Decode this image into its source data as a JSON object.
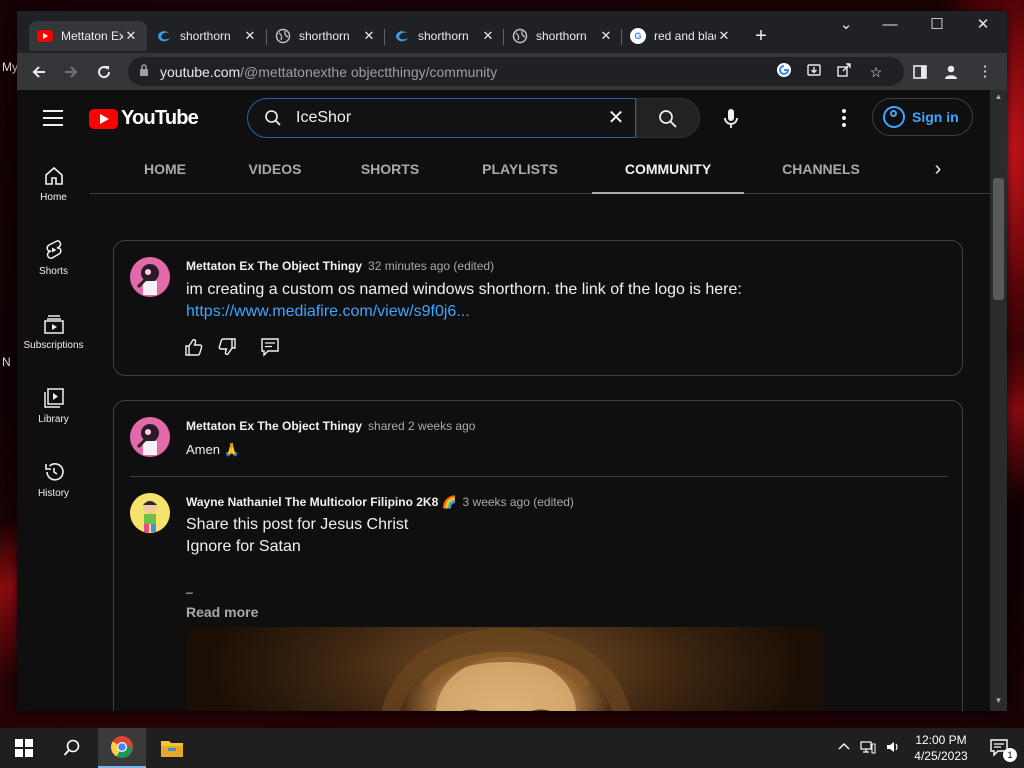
{
  "browser": {
    "tabs": [
      {
        "title": "Mettaton Ex The Object Thingy - YouTube",
        "favicon": "youtube-favicon",
        "active": true
      },
      {
        "title": "shorthorn",
        "favicon": "edge-favicon"
      },
      {
        "title": "shorthorn",
        "favicon": "globe-favicon"
      },
      {
        "title": "shorthorn",
        "favicon": "edge-favicon"
      },
      {
        "title": "shorthorn",
        "favicon": "globe-favicon"
      },
      {
        "title": "red and black",
        "favicon": "google-favicon"
      }
    ],
    "address": {
      "host": "youtube.com",
      "path": "/@mettatonexthe objectthingy/community"
    },
    "controls": {
      "minimize": "—",
      "maximize": "☐",
      "close": "✕",
      "tab_list": "⌄"
    }
  },
  "youtube": {
    "logo_text": "YouTube",
    "search_value": "IceShor",
    "signin_label": "Sign in",
    "guide": [
      {
        "label": "Home",
        "icon": "home-icon"
      },
      {
        "label": "Shorts",
        "icon": "shorts-icon"
      },
      {
        "label": "Subscriptions",
        "icon": "subscriptions-icon"
      },
      {
        "label": "Library",
        "icon": "library-icon"
      },
      {
        "label": "History",
        "icon": "history-icon"
      }
    ],
    "channel_tabs": [
      "HOME",
      "VIDEOS",
      "SHORTS",
      "PLAYLISTS",
      "COMMUNITY",
      "CHANNELS"
    ],
    "active_channel_tab": "COMMUNITY",
    "posts": [
      {
        "author": "Mettaton Ex The Object Thingy",
        "time": "32 minutes ago (edited)",
        "text": "im creating a custom os named windows shorthorn. the link of the logo is here:",
        "link": "https://www.mediafire.com/view/s9f0j6..."
      },
      {
        "author": "Mettaton Ex The Object Thingy",
        "time": "shared 2 weeks ago",
        "text": "Amen 🙏",
        "shared": {
          "author": "Wayne Nathaniel The Multicolor Filipino 2K8 🌈",
          "time": "3 weeks ago (edited)",
          "line1": "Share this post for Jesus Christ",
          "line2": "Ignore for Satan",
          "line3": "_",
          "read_more": "Read more"
        }
      }
    ]
  },
  "taskbar": {
    "time": "12:00 PM",
    "date": "4/25/2023",
    "notification_count": "1"
  },
  "desktop_edge_text": [
    "My",
    "N"
  ]
}
